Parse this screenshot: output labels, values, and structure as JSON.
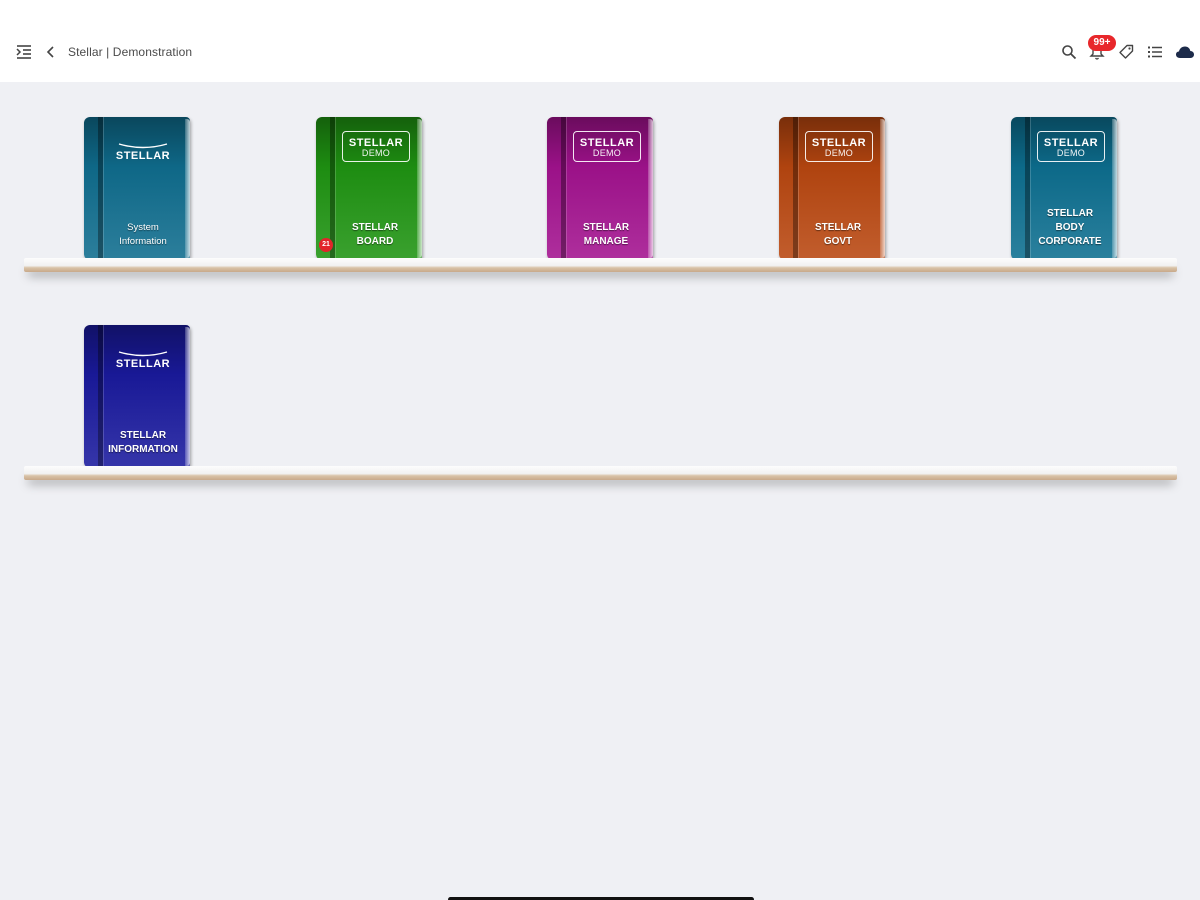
{
  "header": {
    "breadcrumb": "Stellar | Demonstration",
    "notification_badge": "99+",
    "icons": [
      "menu-indent-icon",
      "back-chevron-icon",
      "search-icon",
      "bell-icon",
      "tag-icon",
      "list-icon",
      "cloud-icon"
    ]
  },
  "shelves": [
    {
      "books": [
        {
          "logo": "STELLAR",
          "logo_sub": "",
          "title": "System\nInformation",
          "color": "#0f6d8e",
          "badge": ""
        },
        {
          "logo": "STELLAR",
          "logo_sub": "DEMO",
          "title": "STELLAR\nBOARD",
          "color": "#1f9412",
          "badge": "21"
        },
        {
          "logo": "STELLAR",
          "logo_sub": "DEMO",
          "title": "STELLAR\nMANAGE",
          "color": "#a3128f",
          "badge": ""
        },
        {
          "logo": "STELLAR",
          "logo_sub": "DEMO",
          "title": "STELLAR\nGOVT",
          "color": "#b94710",
          "badge": ""
        },
        {
          "logo": "STELLAR",
          "logo_sub": "DEMO",
          "title": "STELLAR\nBODY\nCORPORATE",
          "color": "#0d6f90",
          "badge": ""
        }
      ]
    },
    {
      "books": [
        {
          "logo": "STELLAR",
          "logo_sub": "",
          "title": "STELLAR\nINFORMATION",
          "color": "#1a1a9e",
          "badge": ""
        }
      ]
    }
  ]
}
